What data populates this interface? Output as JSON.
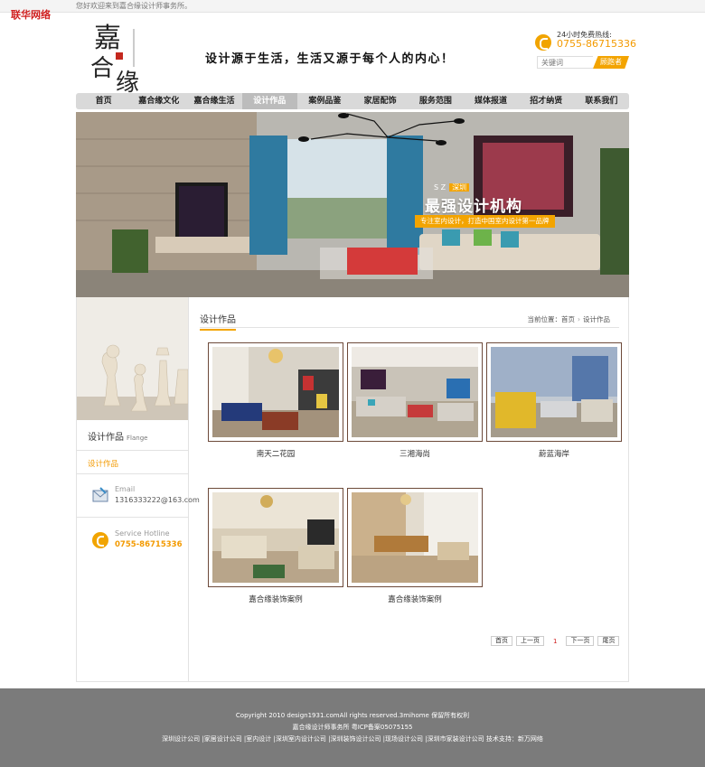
{
  "top": {
    "welcome": "您好欢迎来到嘉合缘设计师事务所。",
    "corner_brand": "联华网络"
  },
  "header": {
    "slogan": "设计源于生活，生活又源于每个人的内心！",
    "hotline_label": "24小时免费热线:",
    "hotline_number": "0755-86715336",
    "search_placeholder": "关键词",
    "search_button": "顾跑者"
  },
  "nav": {
    "items": [
      "首页",
      "嘉合缘文化",
      "嘉合缘生活",
      "设计作品",
      "案例品鉴",
      "家居配饰",
      "服务范围",
      "媒体报道",
      "招才纳贤",
      "联系我们"
    ],
    "active_index": 3
  },
  "banner": {
    "tag_prefix": "S Z",
    "tag_city": "深圳",
    "title": "最强设计机构",
    "subtitle": "专注室内设计，打造中国室内设计第一品牌"
  },
  "sidebar": {
    "title": "设计作品",
    "title_en": "Flange",
    "category": "设计作品",
    "email_label": "Email",
    "email_value": "1316333222@163.com",
    "service_label": "Service Hotline",
    "service_value": "0755-86715336"
  },
  "main": {
    "title": "设计作品",
    "breadcrumb_prefix": "当前位置：",
    "breadcrumb_home": "首页",
    "breadcrumb_current": "设计作品",
    "works": [
      {
        "caption": "南天二花园"
      },
      {
        "caption": "三湘海尚"
      },
      {
        "caption": "蔚蓝海岸"
      },
      {
        "caption": "嘉合缘装饰案例"
      },
      {
        "caption": "嘉合缘装饰案例"
      }
    ]
  },
  "pagination": {
    "first": "首页",
    "prev": "上一页",
    "current": "1",
    "next": "下一页",
    "last": "尾页"
  },
  "footer": {
    "copyright": "Copyright 2010 design1931.comAll rights reserved.3mihome 保留所有权利",
    "company": "嘉合缘设计师事务所  粤ICP备案05075155",
    "links": "深圳设计公司 |家居设计公司 |室内设计 |深圳室内设计公司 |深圳装饰设计公司 |现场设计公司 |深圳市家装设计公司  技术支持：新万网络"
  },
  "colors": {
    "accent": "#f3a400",
    "nav_bg": "#d9d9d9",
    "footer_bg": "#7b7b7b"
  }
}
